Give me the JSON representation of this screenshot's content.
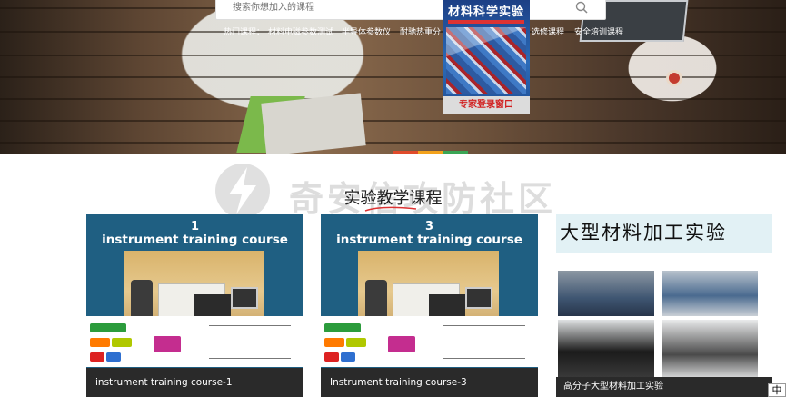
{
  "search": {
    "placeholder": "搜索你想加入的课程",
    "icon": "search-icon"
  },
  "hot_courses": {
    "label": "热门课程：",
    "items": [
      "材料电磁参数测试",
      "半导体参数仪",
      "耐驰热重分",
      "选修课程",
      "安全培训课程"
    ]
  },
  "promo_book": {
    "title": "材料科学实验",
    "login_label": "专家登录窗口"
  },
  "watermark": {
    "text": "奇安信攻防社区"
  },
  "section": {
    "title": "实验教学课程",
    "accent_colors": [
      "#e04b2b",
      "#f3a21b",
      "#3aa655"
    ]
  },
  "courses": [
    {
      "number": "1",
      "heading": "instrument training course",
      "caption": "instrument training course-1"
    },
    {
      "number": "3",
      "heading": "instrument training course",
      "caption": "Instrument training course-3"
    },
    {
      "title": "大型材料加工实验",
      "caption": "高分子大型材料加工实验"
    }
  ],
  "lang_toggle": "中",
  "colors": {
    "card_bg": "#1f5f82",
    "caption_bg": "#2a2a2a",
    "hero_wood": "#6b503a"
  }
}
